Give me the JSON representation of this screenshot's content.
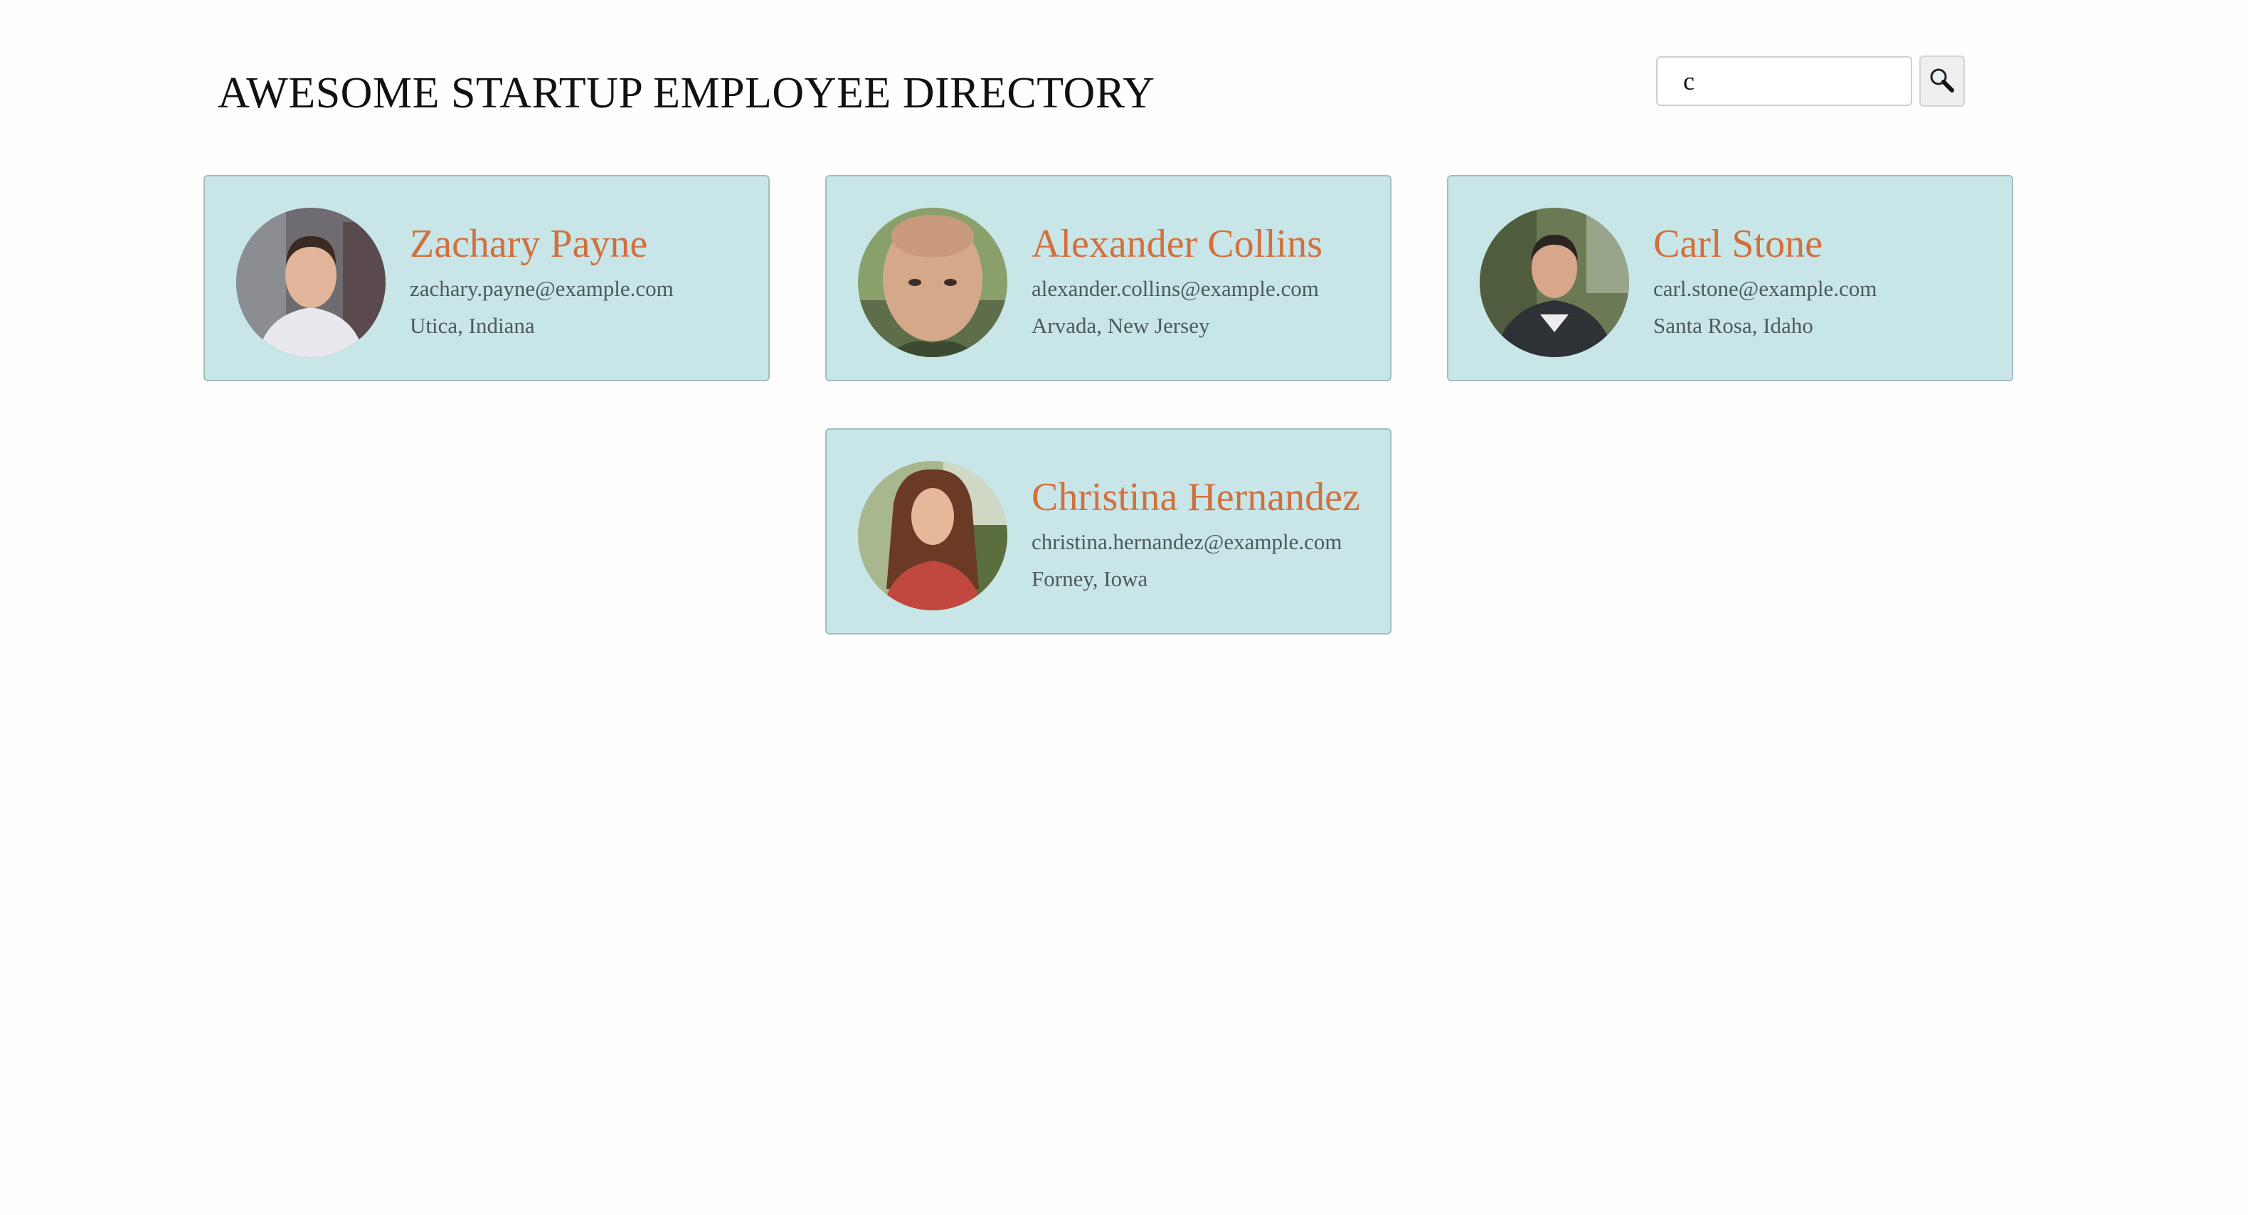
{
  "header": {
    "title": "AWESOME STARTUP EMPLOYEE DIRECTORY"
  },
  "search": {
    "value": "c",
    "button_icon": "magnifying-glass-icon"
  },
  "employees": [
    {
      "name": "Zachary Payne",
      "email": "zachary.payne@example.com",
      "location": "Utica, Indiana"
    },
    {
      "name": "Alexander Collins",
      "email": "alexander.collins@example.com",
      "location": "Arvada, New Jersey"
    },
    {
      "name": "Carl Stone",
      "email": "carl.stone@example.com",
      "location": "Santa Rosa, Idaho"
    },
    {
      "name": "Christina Hernandez",
      "email": "christina.hernandez@example.com",
      "location": "Forney, Iowa"
    }
  ],
  "colors": {
    "card_background": "#c8e6e8",
    "name_accent": "#d2703d",
    "detail_text": "#4e5a5a"
  }
}
